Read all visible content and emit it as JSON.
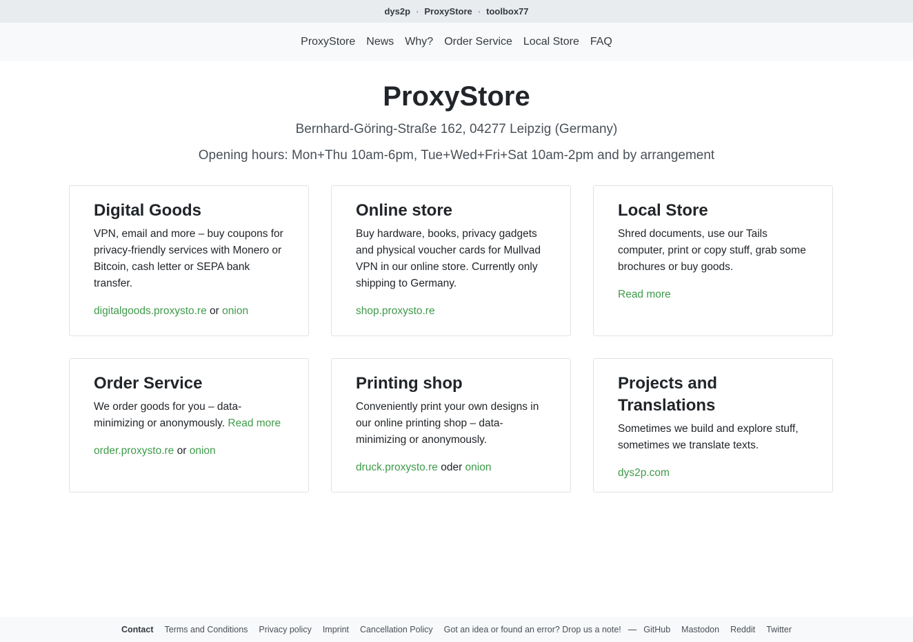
{
  "topbar": {
    "items": [
      "dys2p",
      "ProxyStore",
      "toolbox77"
    ],
    "separator": "·"
  },
  "nav": {
    "items": [
      "ProxyStore",
      "News",
      "Why?",
      "Order Service",
      "Local Store",
      "FAQ"
    ]
  },
  "hero": {
    "title": "ProxyStore",
    "address": "Bernhard-Göring-Straße 162, 04277 Leipzig (Germany)",
    "hours": "Opening hours: Mon+Thu 10am-6pm, Tue+Wed+Fri+Sat 10am-2pm and by arrangement"
  },
  "cards": [
    {
      "title": "Digital Goods",
      "text": "VPN, email and more – buy coupons for privacy-friendly services with Monero or Bitcoin, cash letter or SEPA bank transfer.",
      "link1": "digitalgoods.proxysto.re",
      "joiner": "or",
      "link2": "onion"
    },
    {
      "title": "Online store",
      "text": "Buy hardware, books, privacy gadgets and physical voucher cards for Mullvad VPN in our online store. Currently only shipping to Germany.",
      "link1": "shop.proxysto.re"
    },
    {
      "title": "Local Store",
      "text": "Shred documents, use our Tails computer, print or copy stuff, grab some brochures or buy goods.",
      "link1": "Read more"
    },
    {
      "title": "Order Service",
      "text": "We order goods for you – data-minimizing or anonymously.",
      "inline_link": "Read more",
      "link1": "order.proxysto.re",
      "joiner": "or",
      "link2": "onion"
    },
    {
      "title": "Printing shop",
      "text": "Conveniently print your own designs in our online printing shop – data-minimizing or anonymously.",
      "link1": "druck.proxysto.re",
      "joiner": "oder",
      "link2": "onion"
    },
    {
      "title": "Projects and Translations",
      "text": "Sometimes we build and explore stuff, sometimes we translate texts.",
      "link1": "dys2p.com"
    }
  ],
  "footer": {
    "contact": "Contact",
    "links": [
      "Terms and Conditions",
      "Privacy policy",
      "Imprint",
      "Cancellation Policy",
      "Got an idea or found an error? Drop us a note!"
    ],
    "dash": "—",
    "social": [
      "GitHub",
      "Mastodon",
      "Reddit",
      "Twitter"
    ]
  },
  "colors": {
    "link": "#3f9a4a",
    "topbar_bg": "#e9ecef",
    "nav_bg": "#f8f9fa",
    "card_border": "#dee2e6"
  }
}
